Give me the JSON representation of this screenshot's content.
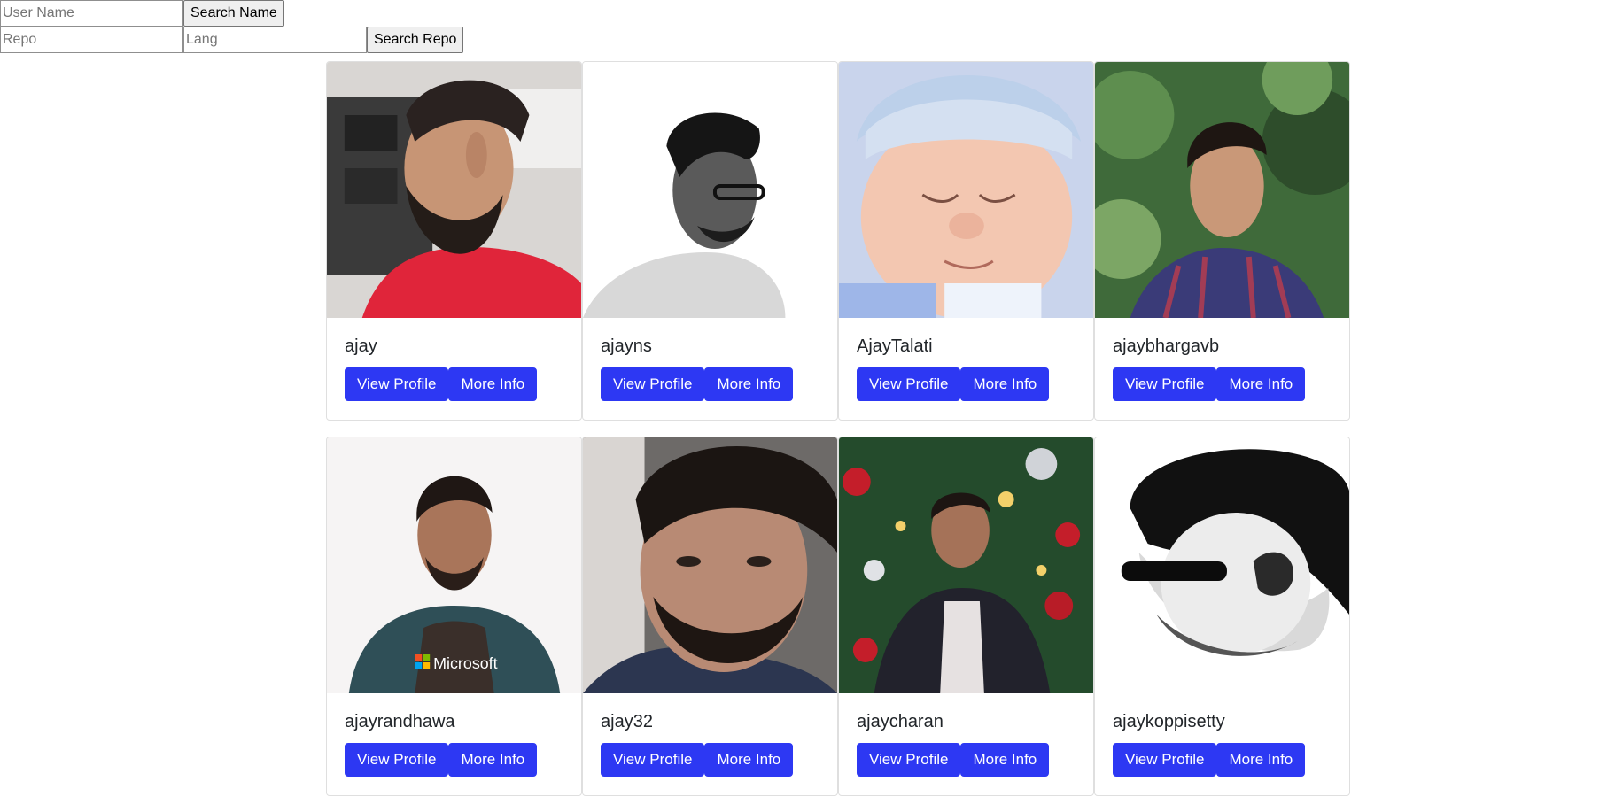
{
  "search_user": {
    "placeholder": "User Name",
    "button": "Search Name"
  },
  "search_repo": {
    "repo_placeholder": "Repo",
    "lang_placeholder": "Lang",
    "button": "Search Repo"
  },
  "buttons": {
    "view": "View Profile",
    "more": "More Info"
  },
  "colors": {
    "button_bg": "#2d38f3",
    "card_border": "#dfdfdf"
  },
  "users": [
    {
      "login": "ajay"
    },
    {
      "login": "ajayns"
    },
    {
      "login": "AjayTalati"
    },
    {
      "login": "ajaybhargavb"
    },
    {
      "login": "ajayrandhawa"
    },
    {
      "login": "ajay32"
    },
    {
      "login": "ajaycharan"
    },
    {
      "login": "ajaykoppisetty"
    }
  ],
  "avatar_logo_text": "Microsoft"
}
